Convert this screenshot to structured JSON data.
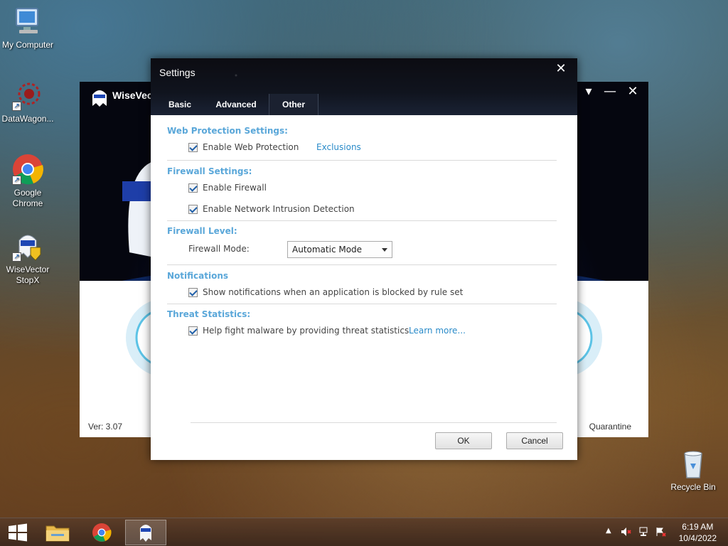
{
  "desktop": {
    "icons": [
      {
        "label": "My Computer",
        "icon": "computer-icon"
      },
      {
        "label": "DataWagon...",
        "icon": "datawagon-icon"
      },
      {
        "label": "Google Chrome",
        "icon": "chrome-icon"
      },
      {
        "label": "WiseVector StopX",
        "icon": "wisevector-icon"
      },
      {
        "label": "Recycle Bin",
        "icon": "recycle-bin-icon"
      }
    ]
  },
  "main_window": {
    "title": "WiseVector",
    "version": "Ver: 3.07",
    "quarantine_label": "Quarantine"
  },
  "settings": {
    "title": "Settings",
    "tabs": [
      {
        "label": "Basic",
        "active": false
      },
      {
        "label": "Advanced",
        "active": false
      },
      {
        "label": "Other",
        "active": true
      }
    ],
    "web_protection": {
      "title": "Web Protection Settings:",
      "enable_label": "Enable Web Protection",
      "enable_checked": true,
      "exclusions_link": "Exclusions"
    },
    "firewall": {
      "title": "Firewall Settings:",
      "enable_label": "Enable Firewall",
      "enable_checked": true,
      "nid_label": "Enable Network Intrusion Detection",
      "nid_checked": true
    },
    "firewall_level": {
      "title": "Firewall Level:",
      "mode_label": "Firewall Mode:",
      "mode_value": "Automatic Mode"
    },
    "notifications": {
      "title": "Notifications",
      "show_label": "Show notifications when an application is blocked by rule set",
      "show_checked": true
    },
    "threat_stats": {
      "title": "Threat Statistics:",
      "help_label": "Help fight malware by providing threat statistics",
      "help_checked": true,
      "learn_more_link": "Learn more..."
    },
    "ok_label": "OK",
    "cancel_label": "Cancel"
  },
  "taskbar": {
    "time": "6:19 AM",
    "date": "10/4/2022"
  },
  "colors": {
    "section_title": "#5aa7d9",
    "link": "#2a8bc9",
    "checkmark": "#1f5fa8"
  }
}
